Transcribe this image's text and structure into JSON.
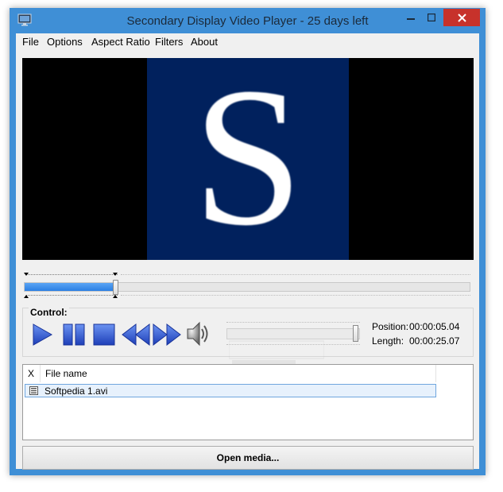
{
  "window": {
    "title": "Secondary Display Video Player - 25 days left"
  },
  "menu": {
    "items": [
      {
        "label": "File"
      },
      {
        "label": "Options"
      },
      {
        "label": "Aspect Ratio"
      },
      {
        "label": "Filters"
      },
      {
        "label": "About"
      }
    ]
  },
  "video": {
    "frame_text": "S",
    "colors": {
      "frame": "#01215d",
      "letterbox": "#000000"
    }
  },
  "seek": {
    "progress_fraction": 0.2
  },
  "control": {
    "label": "Control:",
    "buttons": [
      "play-icon",
      "pause-icon",
      "stop-icon",
      "rewind-icon",
      "fast-forward-icon",
      "speaker-icon"
    ],
    "volume_fraction": 0.98,
    "position_label": "Position:",
    "position_value": "00:00:05.04",
    "length_label": "Length:",
    "length_value": "00:00:25.07"
  },
  "filelist": {
    "columns": [
      "X",
      "File name"
    ],
    "rows": [
      {
        "name": "Softpedia 1.avi",
        "selected": true
      }
    ]
  },
  "actions": {
    "open_media_label": "Open media..."
  },
  "colors": {
    "window_frame": "#3f8fd6",
    "close_button": "#c7322b",
    "accent_blue": "#2b5fd4"
  }
}
